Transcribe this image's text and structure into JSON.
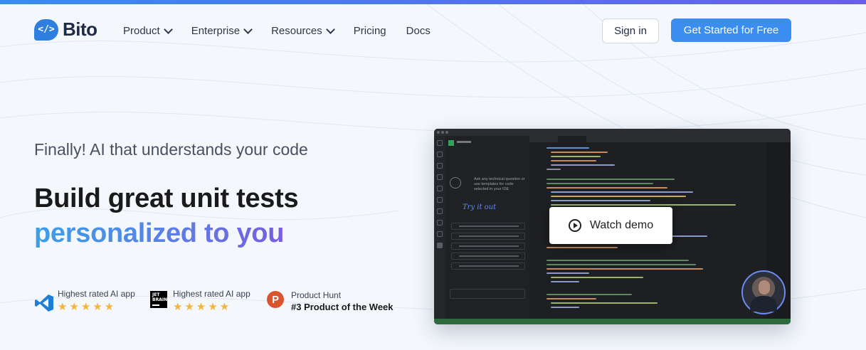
{
  "brand": {
    "logo_glyph": "</>",
    "name": "Bito",
    "primary_color": "#3b8ef0"
  },
  "nav": {
    "items": [
      {
        "label": "Product",
        "dropdown": true
      },
      {
        "label": "Enterprise",
        "dropdown": true
      },
      {
        "label": "Resources",
        "dropdown": true
      },
      {
        "label": "Pricing",
        "dropdown": false
      },
      {
        "label": "Docs",
        "dropdown": false
      }
    ],
    "signin_label": "Sign in",
    "cta_label": "Get Started for Free"
  },
  "hero": {
    "tagline": "Finally! AI that understands your code",
    "headline_line1": "Build great unit tests",
    "headline_line2": "personalized to you"
  },
  "badges": [
    {
      "label": "Highest rated AI app",
      "icon": "vscode-icon",
      "stars": "★★★★★",
      "rating": 5
    },
    {
      "label": "Highest rated AI app",
      "icon": "jetbrains-icon",
      "icon_text": "JET BRAINS",
      "stars": "★★★★★",
      "rating": 4.5
    },
    {
      "label": "Product Hunt",
      "icon": "producthunt-icon",
      "icon_text": "P",
      "rank": "#3 Product of the Week"
    }
  ],
  "demo": {
    "panel_prompt": "Ask any technical question or use templates for code selected in your IDE",
    "try_label": "Try it out",
    "watch_label": "Watch demo"
  }
}
